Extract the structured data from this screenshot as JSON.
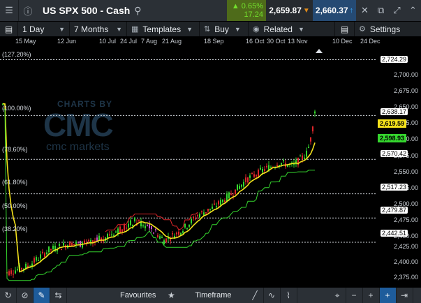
{
  "header": {
    "instrument": "US SPX 500 - Cash",
    "change_pct": "▲ 0.65%",
    "change_abs": "17.24",
    "sell_price": "2,659.87",
    "buy_price": "2,660.37"
  },
  "toolbar": {
    "interval": "1 Day",
    "range": "7 Months",
    "templates": "Templates",
    "buy": "Buy",
    "related": "Related",
    "settings": "Settings"
  },
  "date_axis": [
    "15 May",
    "12 Jun",
    "10 Jul",
    "24 Jul",
    "7 Aug",
    "21 Aug",
    "18 Sep",
    "16 Oct",
    "30 Oct",
    "13 Nov",
    "10 Dec",
    "24 Dec"
  ],
  "fib_levels": [
    {
      "label": "(127.20%)",
      "price": "2,724.29"
    },
    {
      "label": "(100.00%)",
      "price": "2,638.17"
    },
    {
      "label": "(78.60%)",
      "price": "2,570.42"
    },
    {
      "label": "(61.80%)",
      "price": "2,517.23"
    },
    {
      "label": "(50.00%)",
      "price": "2,479.87"
    },
    {
      "label": "(38.20%)",
      "price": "2,442.51"
    }
  ],
  "price_ticks": [
    "2,700.00",
    "2,675.00",
    "2,650.00",
    "2,625.00",
    "2,600.00",
    "2,575.00",
    "2,550.00",
    "2,525.00",
    "2,500.00",
    "2,475.00",
    "2,450.00",
    "2,425.00",
    "2,400.00",
    "2,375.00"
  ],
  "indicator_tags": [
    {
      "price": "2,619.59",
      "color": "#f4e21b"
    },
    {
      "price": "2,598.93",
      "color": "#35d62e"
    }
  ],
  "watermark": {
    "top": "CHARTS BY",
    "logo": "CMC",
    "bottom": "cmc markets"
  },
  "footer": {
    "favourites": "Favourites",
    "timeframe": "Timeframe"
  },
  "colors": {
    "up": "#35d62e",
    "down": "#e0262a",
    "ma": "#f4e21b",
    "band": "#35d62e",
    "accent": "#1e5c9b"
  }
}
